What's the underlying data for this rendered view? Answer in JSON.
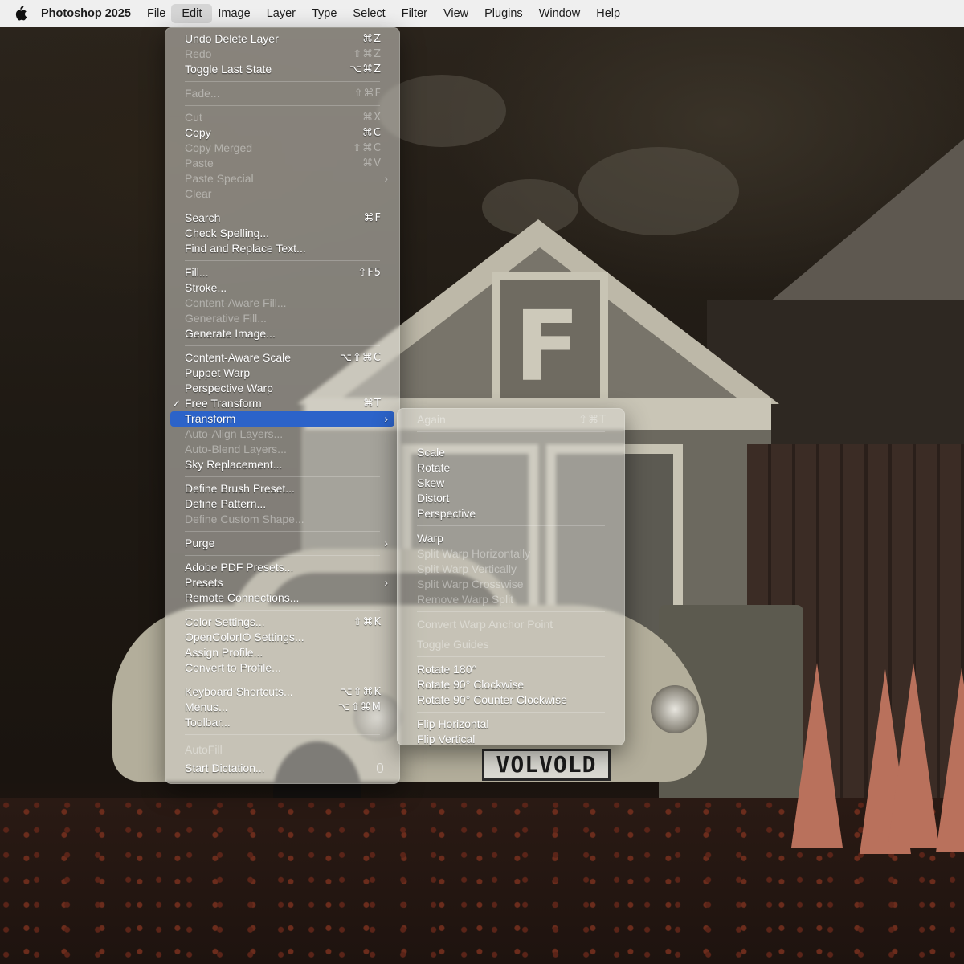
{
  "menubar": {
    "app_name": "Photoshop 2025",
    "items": [
      "File",
      "Edit",
      "Image",
      "Layer",
      "Type",
      "Select",
      "Filter",
      "View",
      "Plugins",
      "Window",
      "Help"
    ]
  },
  "edit_menu": {
    "items": [
      {
        "label": "Undo Delete Layer",
        "shortcut": "⌘Z"
      },
      {
        "label": "Redo",
        "shortcut": "⇧⌘Z",
        "disabled": true
      },
      {
        "label": "Toggle Last State",
        "shortcut": "⌥⌘Z"
      },
      {
        "label": "Fade...",
        "shortcut": "⇧⌘F",
        "disabled": true
      },
      {
        "label": "Cut",
        "shortcut": "⌘X",
        "disabled": true
      },
      {
        "label": "Copy",
        "shortcut": "⌘C"
      },
      {
        "label": "Copy Merged",
        "shortcut": "⇧⌘C",
        "disabled": true
      },
      {
        "label": "Paste",
        "shortcut": "⌘V",
        "disabled": true
      },
      {
        "label": "Paste Special",
        "disabled": true
      },
      {
        "label": "Clear",
        "disabled": true
      },
      {
        "label": "Search",
        "shortcut": "⌘F"
      },
      {
        "label": "Check Spelling..."
      },
      {
        "label": "Find and Replace Text..."
      },
      {
        "label": "Fill...",
        "shortcut": "⇧F5"
      },
      {
        "label": "Stroke..."
      },
      {
        "label": "Content-Aware Fill...",
        "disabled": true
      },
      {
        "label": "Generative Fill...",
        "disabled": true
      },
      {
        "label": "Generate Image..."
      },
      {
        "label": "Content-Aware Scale",
        "shortcut": "⌥⇧⌘C"
      },
      {
        "label": "Puppet Warp"
      },
      {
        "label": "Perspective Warp"
      },
      {
        "label": "Free Transform",
        "shortcut": "⌘T",
        "checked": true
      },
      {
        "label": "Transform"
      },
      {
        "label": "Auto-Align Layers...",
        "disabled": true
      },
      {
        "label": "Auto-Blend Layers...",
        "disabled": true
      },
      {
        "label": "Sky Replacement..."
      },
      {
        "label": "Define Brush Preset..."
      },
      {
        "label": "Define Pattern..."
      },
      {
        "label": "Define Custom Shape...",
        "disabled": true
      },
      {
        "label": "Purge"
      },
      {
        "label": "Adobe PDF Presets..."
      },
      {
        "label": "Presets"
      },
      {
        "label": "Remote Connections..."
      },
      {
        "label": "Color Settings...",
        "shortcut": "⇧⌘K"
      },
      {
        "label": "OpenColorIO Settings..."
      },
      {
        "label": "Assign Profile..."
      },
      {
        "label": "Convert to Profile..."
      },
      {
        "label": "Keyboard Shortcuts...",
        "shortcut": "⌥⇧⌘K"
      },
      {
        "label": "Menus...",
        "shortcut": "⌥⇧⌘M"
      },
      {
        "label": "Toolbar..."
      },
      {
        "label": "AutoFill",
        "disabled": true
      },
      {
        "label": "Start Dictation..."
      }
    ]
  },
  "transform_submenu": {
    "items": [
      {
        "label": "Again",
        "shortcut": "⇧⌘T",
        "disabled": true
      },
      {
        "label": "Scale"
      },
      {
        "label": "Rotate"
      },
      {
        "label": "Skew"
      },
      {
        "label": "Distort"
      },
      {
        "label": "Perspective"
      },
      {
        "label": "Warp"
      },
      {
        "label": "Split Warp Horizontally",
        "disabled": true
      },
      {
        "label": "Split Warp Vertically",
        "disabled": true
      },
      {
        "label": "Split Warp Crosswise",
        "disabled": true
      },
      {
        "label": "Remove Warp Split",
        "disabled": true
      },
      {
        "label": "Convert Warp Anchor Point",
        "disabled": true
      },
      {
        "label": "Toggle Guides",
        "disabled": true
      },
      {
        "label": "Rotate 180°"
      },
      {
        "label": "Rotate 90° Clockwise"
      },
      {
        "label": "Rotate 90° Counter Clockwise"
      },
      {
        "label": "Flip Horizontal"
      },
      {
        "label": "Flip Vertical"
      }
    ]
  },
  "photo": {
    "shed_letter": "F",
    "license_plate": "VOLVOLD"
  },
  "colors": {
    "menubar_bg": "#efefef",
    "highlight": "#2c63c9"
  }
}
